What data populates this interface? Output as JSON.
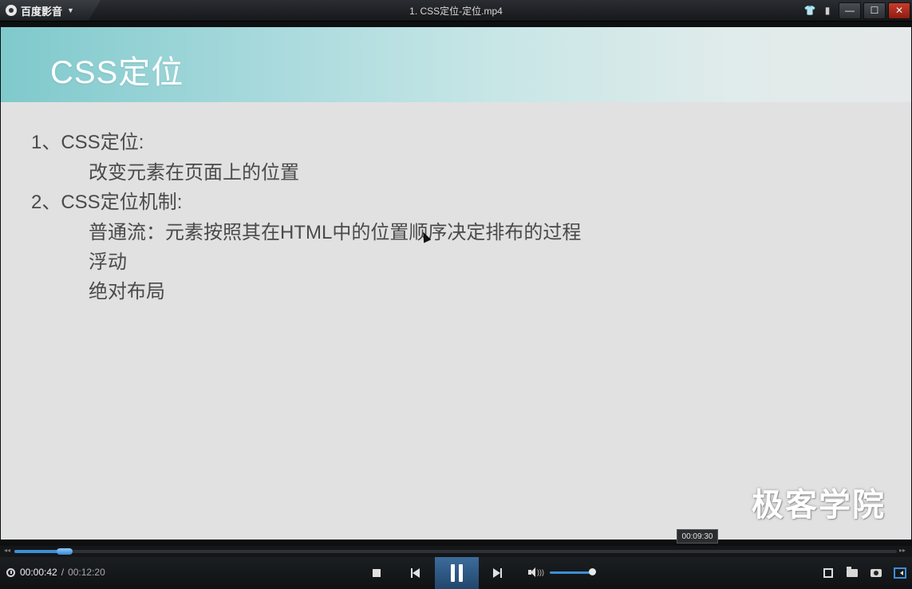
{
  "app": {
    "name": "百度影音",
    "window_title": "1. CSS定位-定位.mp4"
  },
  "slide": {
    "title": "CSS定位",
    "lines": [
      "1、CSS定位:",
      "改变元素在页面上的位置",
      "2、CSS定位机制:",
      "普通流：元素按照其在HTML中的位置顺序决定排布的过程",
      "浮动",
      "绝对布局"
    ],
    "watermark": "极客学院"
  },
  "player": {
    "current_time": "00:00:42",
    "separator": "/",
    "total_time": "00:12:20",
    "hover_time": "00:09:30",
    "progress": 0.057,
    "volume": 1.0
  },
  "colors": {
    "accent": "#3c8fd6",
    "header_teal": "#7fc9cc",
    "slide_bg": "#e1e1e1",
    "close_red": "#c83c2c"
  },
  "icons": {
    "skin": "shirt-icon",
    "feedback": "speech-bubble-icon",
    "minimize": "minimize-icon",
    "maximize": "maximize-icon",
    "close": "close-icon"
  },
  "glyphs": {
    "skin": "👕",
    "feedback": "▮",
    "minimize": "—",
    "maximize": "☐",
    "close": "✕",
    "dropdown": "▼",
    "seek_left": "◂◂",
    "seek_right": "▸▸",
    "volume_wave": ")))"
  }
}
